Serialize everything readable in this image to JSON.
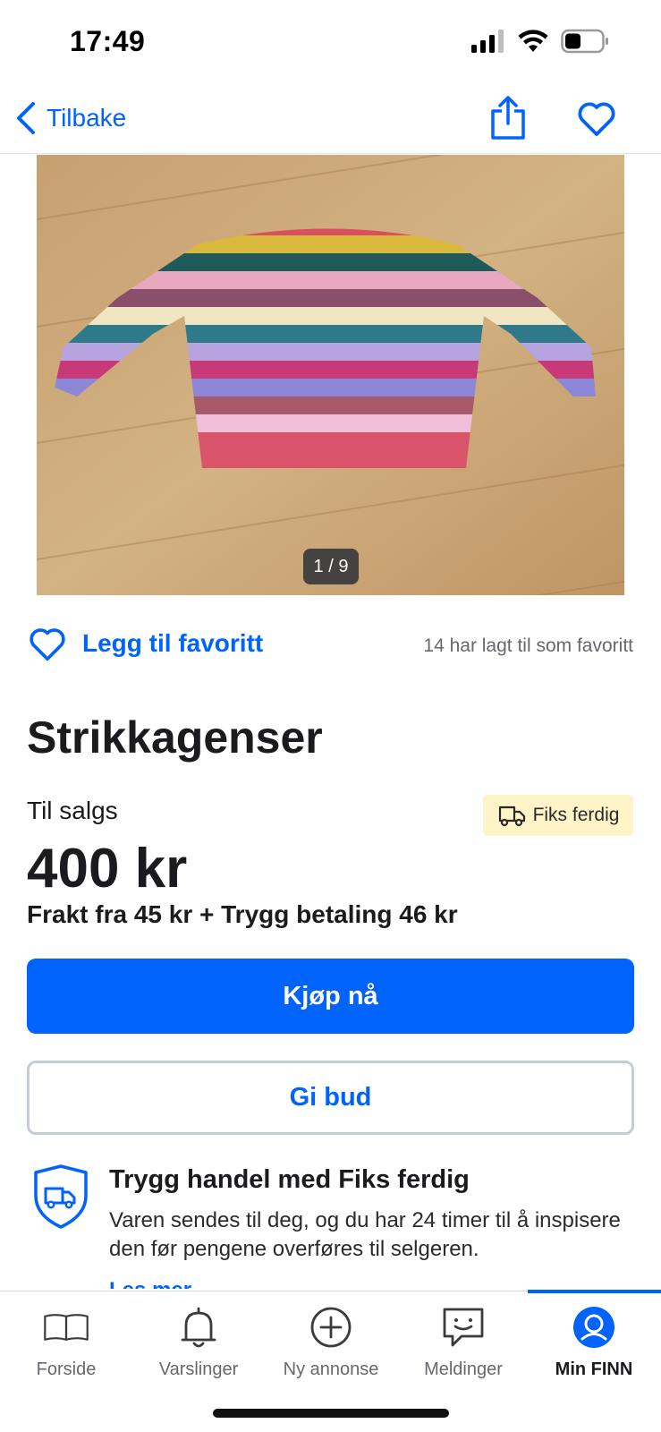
{
  "status_bar": {
    "time": "17:49",
    "icons": [
      "cellular-signal-icon",
      "wifi-icon",
      "battery-icon"
    ]
  },
  "nav": {
    "back_label": "Tilbake",
    "icons": [
      "chevron-left-icon",
      "share-icon",
      "heart-outline-icon"
    ]
  },
  "gallery": {
    "counter": "1 / 9"
  },
  "favorite": {
    "label": "Legg til favoritt",
    "count_text": "14 har lagt til som favoritt"
  },
  "listing": {
    "title": "Strikkagenser",
    "sale_type": "Til salgs",
    "badge": "Fiks ferdig",
    "price": "400 kr",
    "shipping": "Frakt fra 45 kr + Trygg betaling 46 kr"
  },
  "actions": {
    "buy_label": "Kjøp nå",
    "bid_label": "Gi bud"
  },
  "safe_trade": {
    "title": "Trygg handel med Fiks ferdig",
    "text": "Varen sendes til deg, og du har 24 timer til å inspisere den før pengene overføres til selgeren.",
    "more_label": "Les mer"
  },
  "tabs": [
    {
      "label": "Forside",
      "icon": "book-icon",
      "active": false
    },
    {
      "label": "Varslinger",
      "icon": "bell-icon",
      "active": false
    },
    {
      "label": "Ny annonse",
      "icon": "plus-circle-icon",
      "active": false
    },
    {
      "label": "Meldinger",
      "icon": "chat-icon",
      "active": false
    },
    {
      "label": "Min FINN",
      "icon": "profile-icon",
      "active": true
    }
  ],
  "colors": {
    "accent": "#0063fb",
    "badge_bg": "#fff4c8",
    "text": "#1b1b1f",
    "muted": "#67676f"
  }
}
